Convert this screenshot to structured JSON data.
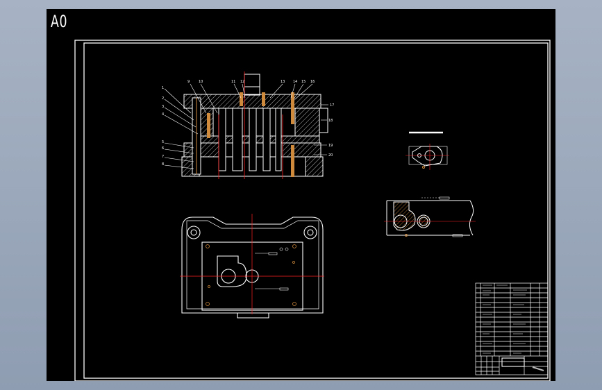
{
  "sheet": {
    "paper_label": "A0",
    "background_color": "#000000",
    "line_color": "#ffffff",
    "centerline_color": "#ff2020",
    "hatch_color": "#d08a3c"
  },
  "section_view": {
    "part_callouts": [
      "1",
      "2",
      "3",
      "4",
      "5",
      "6",
      "7",
      "8",
      "9",
      "10",
      "11",
      "12",
      "13",
      "14",
      "15",
      "16",
      "17",
      "18",
      "19",
      "20",
      "21"
    ]
  },
  "title_block": {
    "rows": 15
  }
}
